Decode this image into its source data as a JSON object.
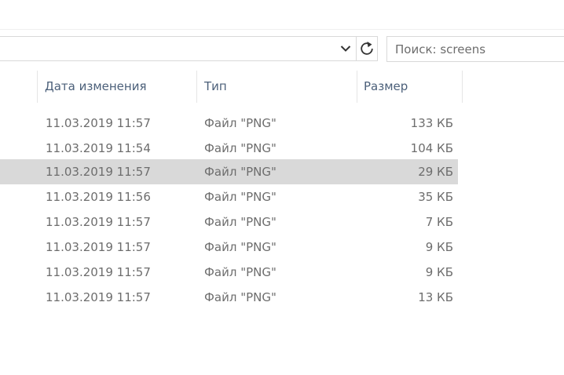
{
  "search": {
    "placeholder": "Поиск: screens"
  },
  "columns": {
    "date": "Дата изменения",
    "type": "Тип",
    "size": "Размер"
  },
  "files": [
    {
      "date": "11.03.2019 11:57",
      "type": "Файл \"PNG\"",
      "size": "133 КБ",
      "selected": false
    },
    {
      "date": "11.03.2019 11:54",
      "type": "Файл \"PNG\"",
      "size": "104 КБ",
      "selected": false
    },
    {
      "date": "11.03.2019 11:57",
      "type": "Файл \"PNG\"",
      "size": "29 КБ",
      "selected": true
    },
    {
      "date": "11.03.2019 11:56",
      "type": "Файл \"PNG\"",
      "size": "35 КБ",
      "selected": false
    },
    {
      "date": "11.03.2019 11:57",
      "type": "Файл \"PNG\"",
      "size": "7 КБ",
      "selected": false
    },
    {
      "date": "11.03.2019 11:57",
      "type": "Файл \"PNG\"",
      "size": "9 КБ",
      "selected": false
    },
    {
      "date": "11.03.2019 11:57",
      "type": "Файл \"PNG\"",
      "size": "9 КБ",
      "selected": false
    },
    {
      "date": "11.03.2019 11:57",
      "type": "Файл \"PNG\"",
      "size": "13 КБ",
      "selected": false
    }
  ],
  "icons": {
    "dropdown": "chevron-down-icon",
    "refresh": "refresh-icon"
  },
  "colors": {
    "selection": "#d9d9d9",
    "header_text": "#4c607a",
    "row_text": "#6d6d6d"
  }
}
